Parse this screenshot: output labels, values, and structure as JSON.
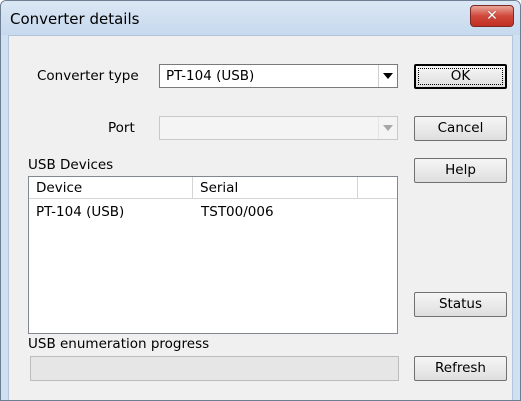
{
  "window": {
    "title": "Converter details"
  },
  "form": {
    "converter_type_label": "Converter type",
    "converter_type_value": "PT-104 (USB)",
    "port_label": "Port",
    "port_value": "",
    "usb_devices_label": "USB Devices"
  },
  "table": {
    "columns": [
      "Device",
      "Serial",
      ""
    ],
    "rows": [
      {
        "device": "PT-104 (USB)",
        "serial": "TST00/006"
      }
    ]
  },
  "progress": {
    "label": "USB enumeration progress",
    "value": 0
  },
  "buttons": {
    "ok": "OK",
    "cancel": "Cancel",
    "help": "Help",
    "status": "Status",
    "refresh": "Refresh"
  },
  "icons": {
    "close": "close-icon",
    "dropdown": "chevron-down-icon"
  },
  "colors": {
    "close_button": "#c9463a",
    "title_bar": "#cfe0f2",
    "client": "#f0f0f0"
  }
}
